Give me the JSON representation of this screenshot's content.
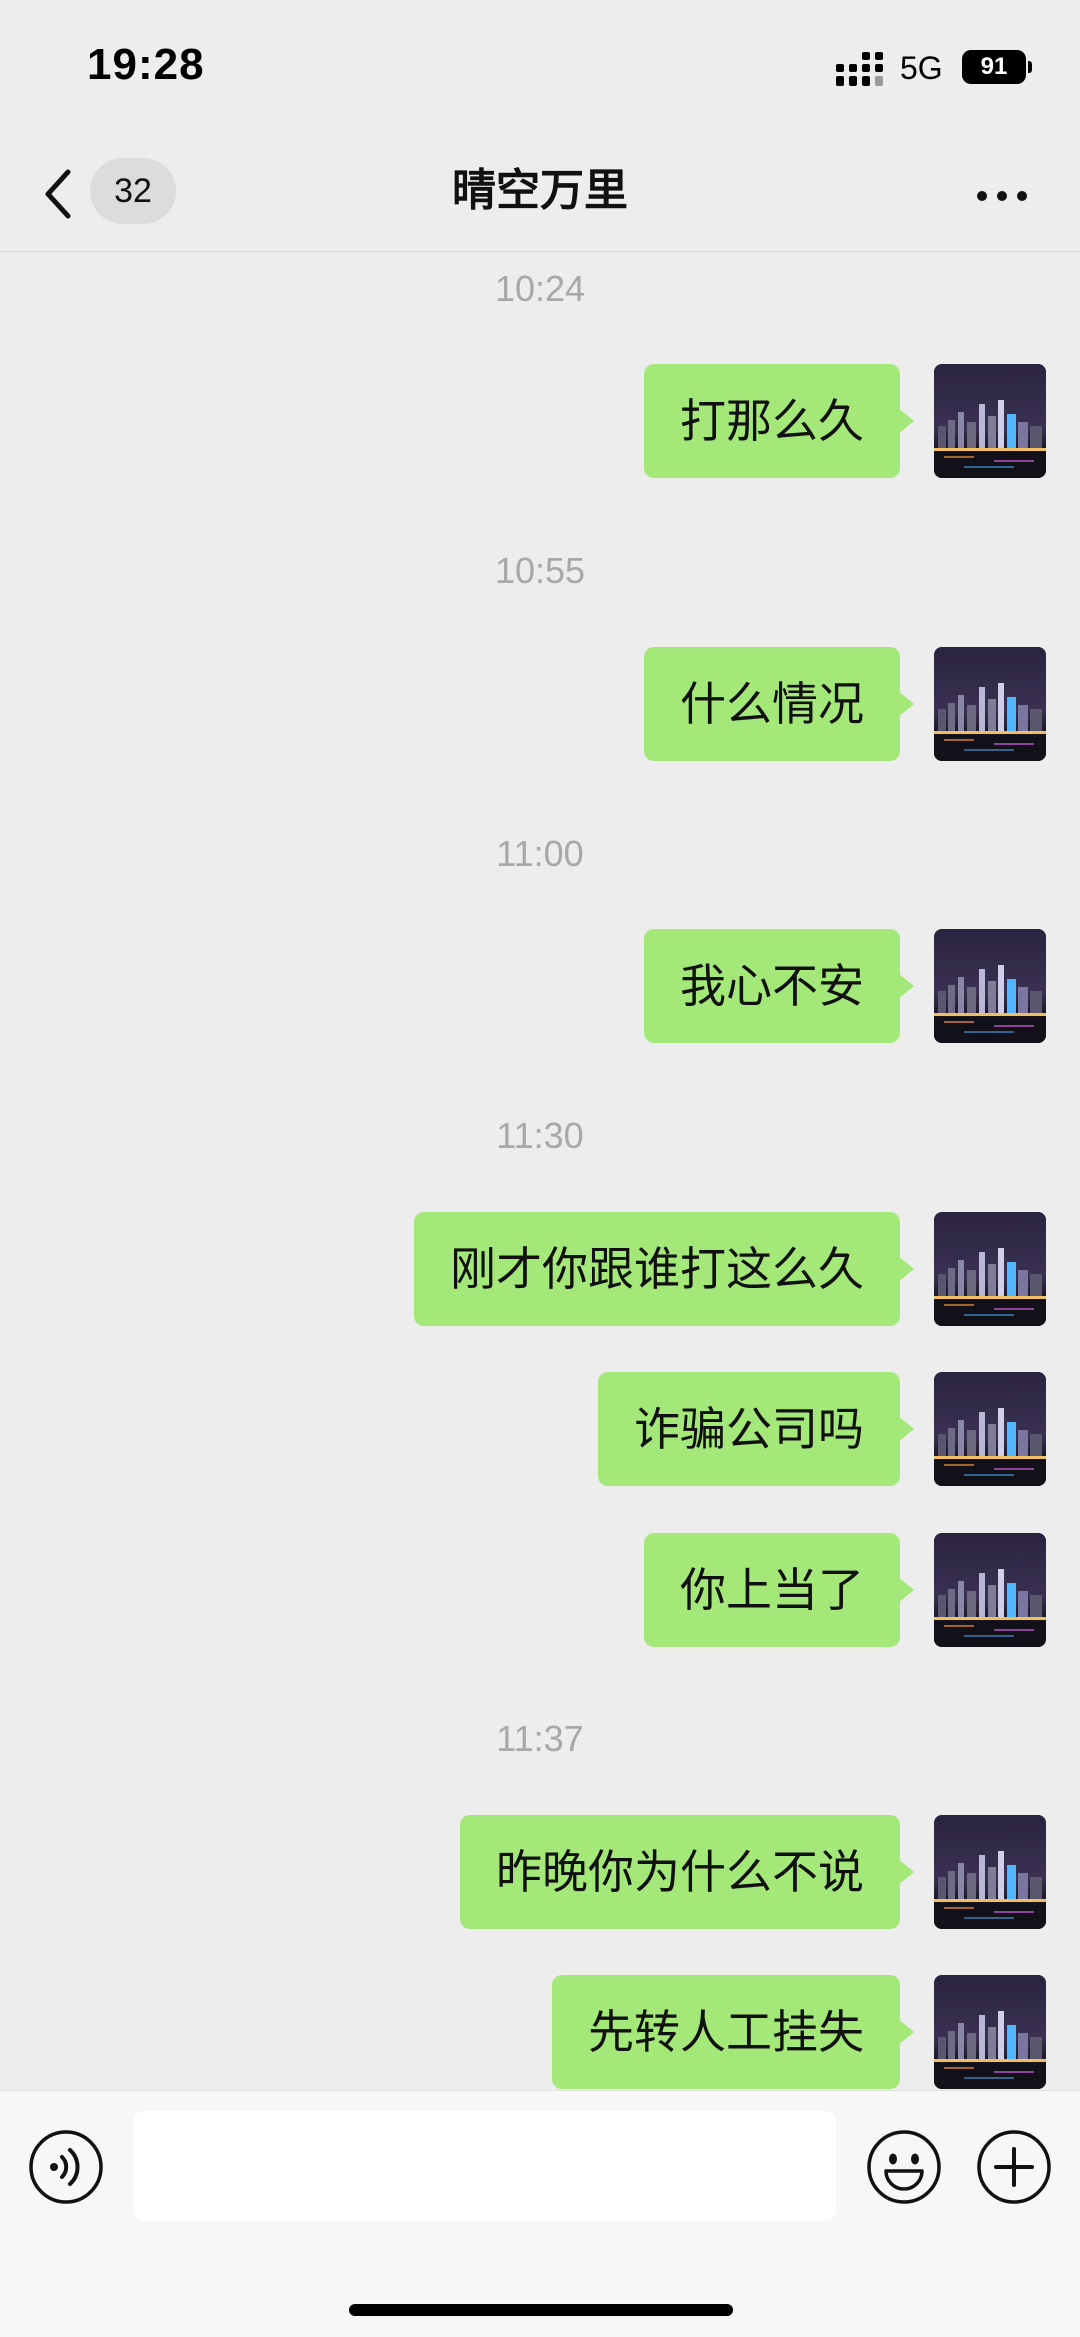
{
  "status_bar": {
    "time": "19:28",
    "network": "5G",
    "battery": "91"
  },
  "header": {
    "unread_count": "32",
    "title": "晴空万里"
  },
  "messages": [
    {
      "type": "time",
      "text": "10:24"
    },
    {
      "type": "sent",
      "text": "打那么久"
    },
    {
      "type": "time",
      "text": "10:55"
    },
    {
      "type": "sent",
      "text": "什么情况"
    },
    {
      "type": "time",
      "text": "11:00"
    },
    {
      "type": "sent",
      "text": "我心不安"
    },
    {
      "type": "time",
      "text": "11:30"
    },
    {
      "type": "sent",
      "text": "刚才你跟谁打这么久"
    },
    {
      "type": "sent",
      "text": "诈骗公司吗"
    },
    {
      "type": "sent",
      "text": "你上当了"
    },
    {
      "type": "time",
      "text": "11:37"
    },
    {
      "type": "sent",
      "text": "昨晚你为什么不说"
    },
    {
      "type": "sent",
      "text": "先转人工挂失"
    }
  ],
  "input": {
    "value": ""
  },
  "icons": {
    "back": "chevron-left-icon",
    "more": "more-horizontal-icon",
    "voice": "voice-input-icon",
    "emoji": "smiley-icon",
    "plus": "plus-circle-icon"
  },
  "colors": {
    "background": "#ededed",
    "sent_bubble": "#a5e87a",
    "timestamp": "#a8a8a8",
    "input_bar": "#f7f7f7"
  }
}
